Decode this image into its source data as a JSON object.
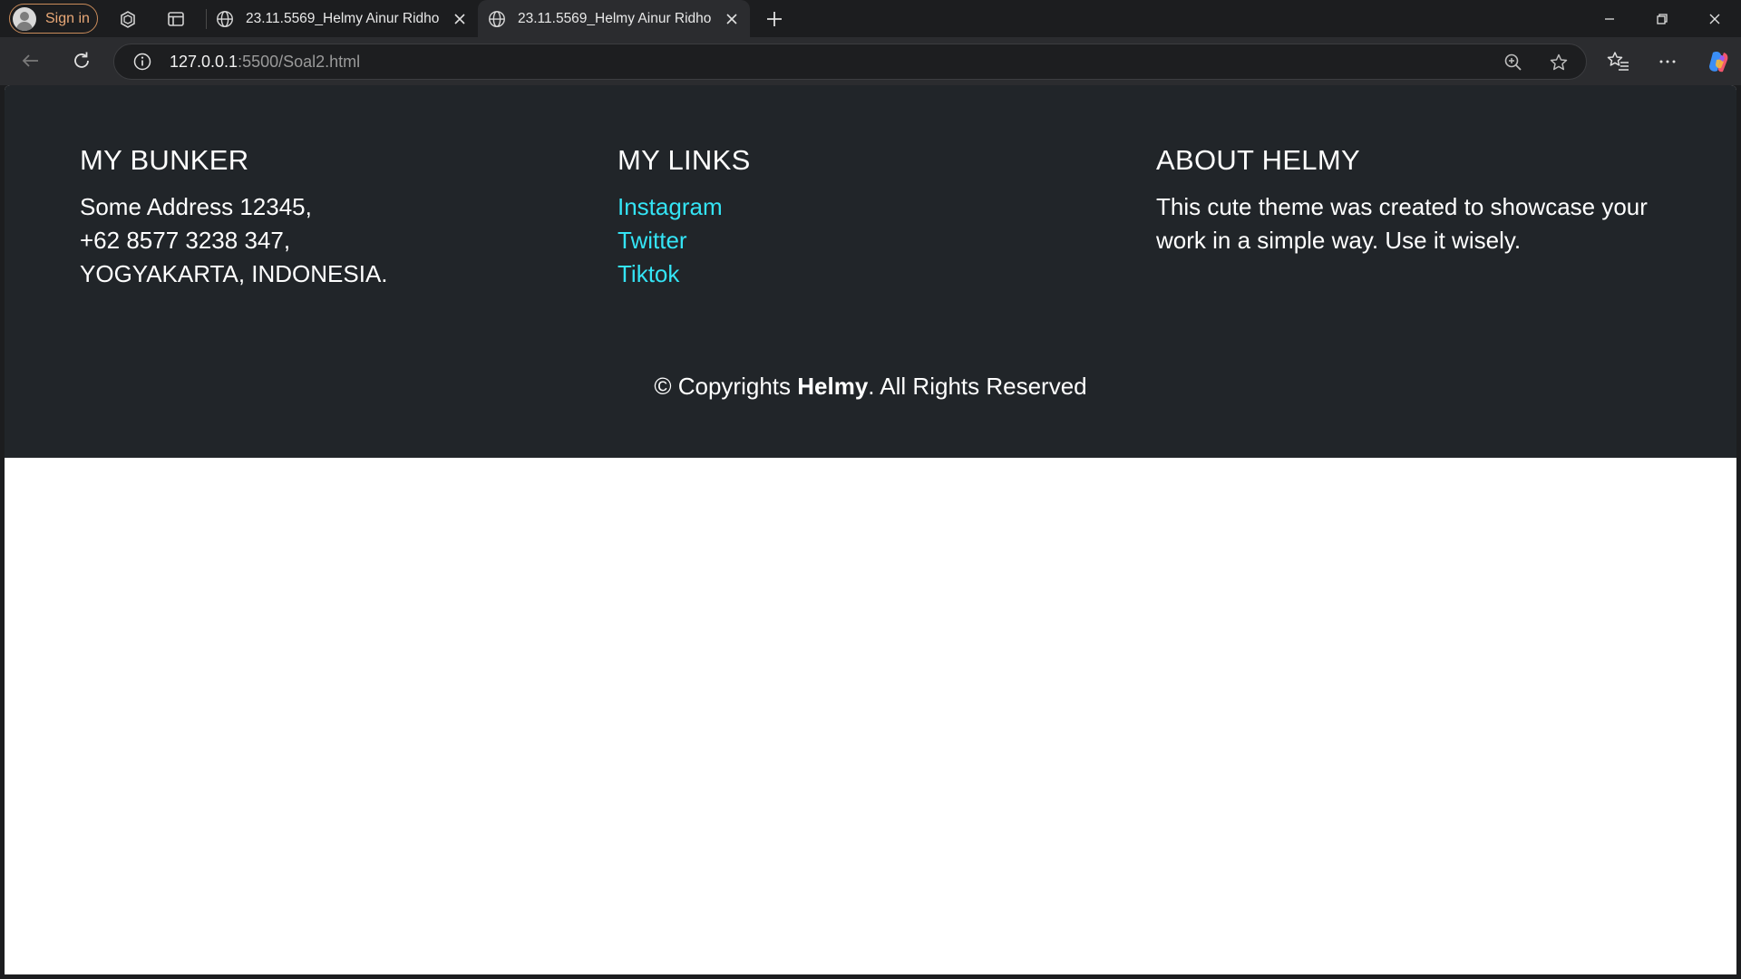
{
  "browser": {
    "signin_label": "Sign in",
    "tabs": [
      {
        "title": "23.11.5569_Helmy Ainur Ridho",
        "active": false
      },
      {
        "title": "23.11.5569_Helmy Ainur Ridho",
        "active": true
      }
    ],
    "url_host": "127.0.0.1",
    "url_rest": ":5500/Soal2.html",
    "accent_signin": "#e9a877"
  },
  "footer": {
    "background": "#212529",
    "link_color": "#34e4f5",
    "bunker": {
      "heading": "MY BUNKER",
      "lines": [
        "Some Address 12345,",
        "+62 8577 3238 347,",
        "YOGYAKARTA, INDONESIA."
      ]
    },
    "links": {
      "heading": "MY LINKS",
      "items": [
        "Instagram",
        "Twitter",
        "Tiktok"
      ]
    },
    "about": {
      "heading": "ABOUT HELMY",
      "text": "This cute theme was created to showcase your work in a simple way. Use it wisely."
    },
    "copyright": {
      "prefix": "© Copyrights ",
      "name": "Helmy",
      "suffix": ". All Rights Reserved"
    }
  }
}
